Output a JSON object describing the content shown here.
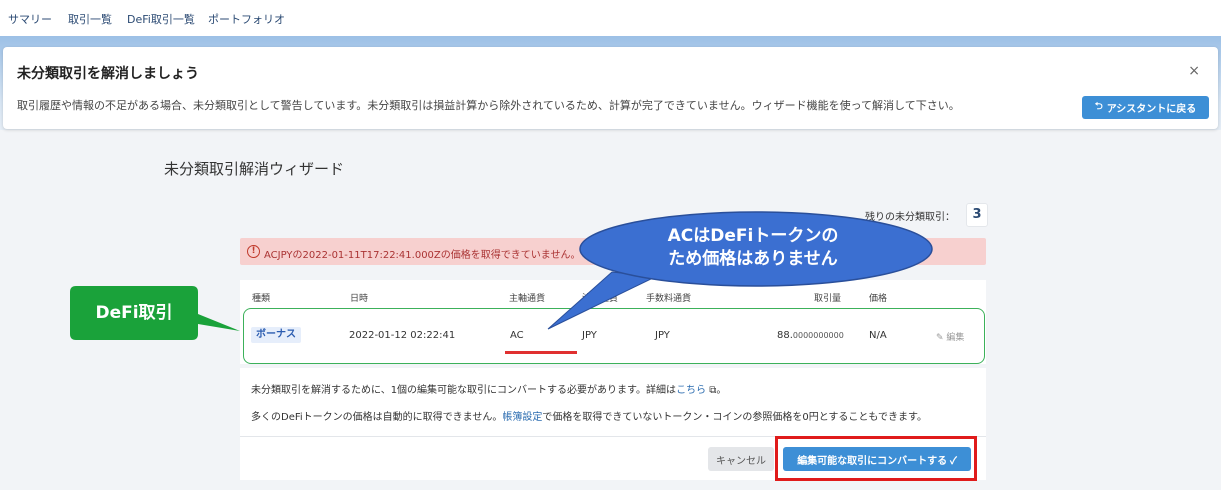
{
  "nav": {
    "items": [
      "サマリー",
      "取引一覧",
      "DeFi取引一覧",
      "ポートフォリオ"
    ]
  },
  "banner": {
    "title": "未分類取引を解消しましょう",
    "text": "取引履歴や情報の不足がある場合、未分類取引として警告しています。未分類取引は損益計算から除外されているため、計算が完了できていません。ウィザード機能を使って解消して下さい。",
    "close": "×",
    "assistant_button": "アシスタントに戻る",
    "assistant_icon": "⮌"
  },
  "wizard": {
    "title": "未分類取引解消ウィザード",
    "remaining_label": "残りの未分類取引：",
    "remaining_count": "3",
    "error_icon": "!",
    "error": "ACJPYの2022-01-11T17:22:41.000Zの価格を取得できていません。"
  },
  "table": {
    "headers": {
      "type": "種類",
      "datetime": "日時",
      "base": "主軸通貨",
      "settle": "決済通貨",
      "fee": "手数料通貨",
      "amount": "取引量",
      "price": "価格"
    },
    "row": {
      "type": "ボーナス",
      "datetime": "2022-01-12 02:22:41",
      "base": "AC",
      "settle": "JPY",
      "fee": "JPY",
      "amount_int": "88.",
      "amount_dec": "0000000000",
      "price": "N/A",
      "edit": "編集",
      "edit_icon": "✎"
    }
  },
  "info": {
    "line1_a": "未分類取引を解消するために、1個の編集可能な取引にコンバートする必要があります。詳細は",
    "line1_link": "こちら",
    "line1_b": " ⧉。",
    "line2_a": "多くのDeFiトークンの価格は自動的に取得できません。",
    "line2_link": "帳簿設定",
    "line2_b": "で価格を取得できていないトークン・コインの参照価格を0円とすることもできます。"
  },
  "actions": {
    "cancel": "キャンセル",
    "convert": "編集可能な取引にコンバートする ✓"
  },
  "callouts": {
    "green": "DeFi取引",
    "oval_line1": "ACはDeFiトークンの",
    "oval_line2": "ため価格はありません"
  },
  "colors": {
    "accent": "#3d8fd6",
    "callout_green": "#1aa23a",
    "oval_blue": "#3b6fd1",
    "highlight_red": "#e01b1b"
  }
}
